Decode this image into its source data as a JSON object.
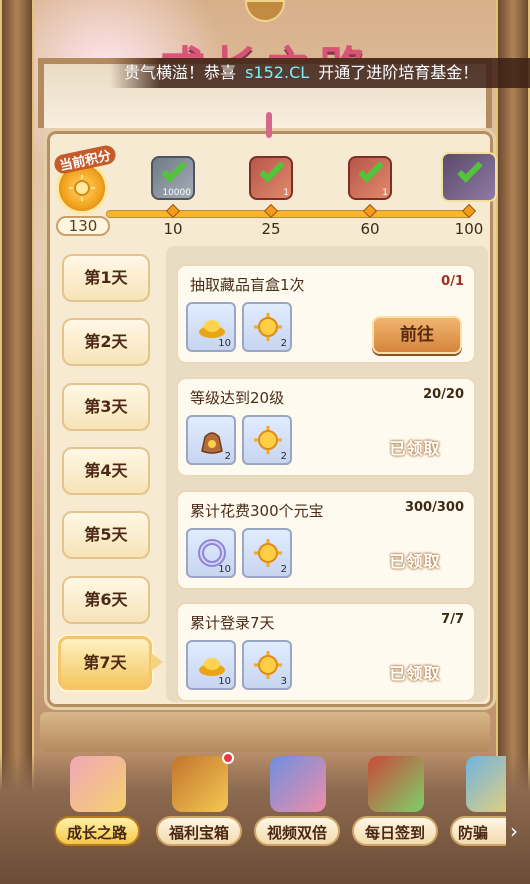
{
  "announcement": {
    "prefix": "贵气横溢！恭喜",
    "player": "s152.CL",
    "suffix": "开通了进阶培育基金！"
  },
  "title": "成长之路",
  "score": {
    "label": "当前积分",
    "value": "130",
    "icon": "sun-medal-icon"
  },
  "progress": {
    "current": 130,
    "max": 100,
    "milestones": [
      {
        "points": "10",
        "qty": "10000",
        "claimed": true,
        "icon": "silver-chest-icon"
      },
      {
        "points": "25",
        "qty": "1",
        "claimed": true,
        "icon": "gift-box-icon"
      },
      {
        "points": "60",
        "qty": "1",
        "claimed": true,
        "icon": "gift-box-icon"
      },
      {
        "points": "100",
        "qty": "",
        "claimed": true,
        "icon": "flower-plant-icon"
      }
    ]
  },
  "days": [
    {
      "label": "第1天"
    },
    {
      "label": "第2天"
    },
    {
      "label": "第3天"
    },
    {
      "label": "第4天"
    },
    {
      "label": "第5天"
    },
    {
      "label": "第6天"
    },
    {
      "label": "第7天",
      "active": true
    }
  ],
  "tasks": [
    {
      "title": "抽取藏品盲盒1次",
      "progress": "0/1",
      "status": "go",
      "action_label": "前往",
      "rewards": [
        {
          "icon": "gold-ingot-icon",
          "qty": "10"
        },
        {
          "icon": "sun-token-icon",
          "qty": "2"
        }
      ]
    },
    {
      "title": "等级达到20级",
      "progress": "20/20",
      "status": "claimed",
      "action_label": "已领取",
      "rewards": [
        {
          "icon": "coin-bag-icon",
          "qty": "2"
        },
        {
          "icon": "sun-token-icon",
          "qty": "2"
        }
      ]
    },
    {
      "title": "累计花费300个元宝",
      "progress": "300/300",
      "status": "claimed",
      "action_label": "已领取",
      "rewards": [
        {
          "icon": "jade-ring-icon",
          "qty": "10"
        },
        {
          "icon": "sun-token-icon",
          "qty": "2"
        }
      ]
    },
    {
      "title": "累计登录7天",
      "progress": "7/7",
      "status": "claimed",
      "action_label": "已领取",
      "rewards": [
        {
          "icon": "gold-ingot-icon",
          "qty": "10"
        },
        {
          "icon": "sun-token-icon",
          "qty": "3"
        }
      ]
    }
  ],
  "bottom_nav": [
    {
      "label": "成长之路",
      "icon": "growth-road-icon",
      "active": true
    },
    {
      "label": "福利宝箱",
      "icon": "treasure-chest-icon",
      "badge": true
    },
    {
      "label": "视频双倍",
      "icon": "video-double-icon"
    },
    {
      "label": "每日签到",
      "icon": "daily-checkin-icon"
    },
    {
      "label": "防骗",
      "icon": "anti-fraud-icon"
    }
  ],
  "colors": {
    "accent": "#f4c94a",
    "progress_red": "#9a2f1f",
    "check_green": "#52c43b"
  }
}
